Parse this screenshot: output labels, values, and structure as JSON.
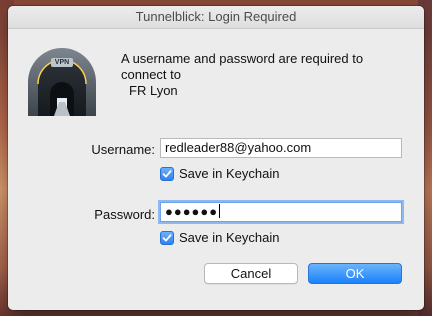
{
  "window": {
    "title": "Tunnelblick: Login Required"
  },
  "icon": {
    "name": "tunnelblick-vpn-tunnel-icon",
    "label": "VPN"
  },
  "message": {
    "text": "A username and password are required to connect to",
    "server": "FR Lyon"
  },
  "username": {
    "label": "Username:",
    "value": "redleader88@yahoo.com",
    "save_label": "Save in Keychain",
    "save_checked": true
  },
  "password": {
    "label": "Password:",
    "masked_value": "●●●●●●",
    "save_label": "Save in Keychain",
    "save_checked": true
  },
  "buttons": {
    "cancel": "Cancel",
    "ok": "OK"
  },
  "colors": {
    "accent": "#1a82fb",
    "window_bg": "#ececec"
  }
}
